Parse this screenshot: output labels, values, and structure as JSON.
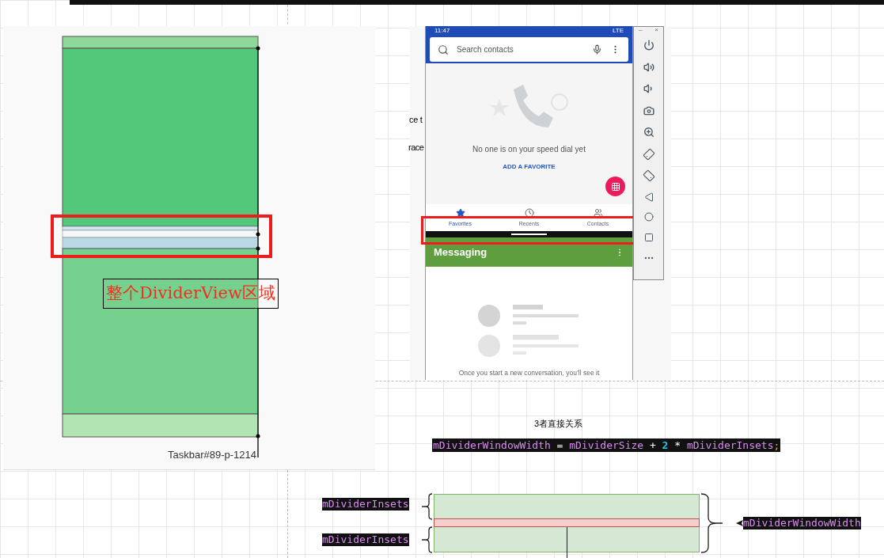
{
  "left_diagram": {
    "label": "整个DividerView区域",
    "caption": "Taskbar#89-p-1214"
  },
  "background_texts": [
    "ce t",
    "race"
  ],
  "phone": {
    "status_time": "11:47",
    "status_network": "LTE",
    "search_placeholder": "Search contacts",
    "empty_message": "No one is on your speed dial yet",
    "add_favorite": "ADD A FAVORITE",
    "tabs": [
      {
        "label": "Favorites",
        "kind": "star",
        "selected": true
      },
      {
        "label": "Recents",
        "kind": "clock",
        "selected": false
      },
      {
        "label": "Contacts",
        "kind": "people",
        "selected": false
      }
    ],
    "messaging_title": "Messaging",
    "messaging_hint": "Once you start a new conversation, you’ll see it"
  },
  "emulator_toolbar": {
    "minimize": "–",
    "close": "×"
  },
  "relation_title": "3者直接关系",
  "formula": [
    {
      "text": "mDividerWindowWidth",
      "kind": "var"
    },
    {
      "text": " = ",
      "kind": "op"
    },
    {
      "text": "mDividerSize",
      "kind": "var"
    },
    {
      "text": " + ",
      "kind": "op"
    },
    {
      "text": "2",
      "kind": "num"
    },
    {
      "text": " * ",
      "kind": "op"
    },
    {
      "text": "mDividerInsets",
      "kind": "var"
    },
    {
      "text": ";",
      "kind": "punct"
    }
  ],
  "bracket_labels": {
    "top": "mDividerInsets",
    "bottom": "mDividerInsets",
    "right": "mDividerWindowWidth"
  }
}
